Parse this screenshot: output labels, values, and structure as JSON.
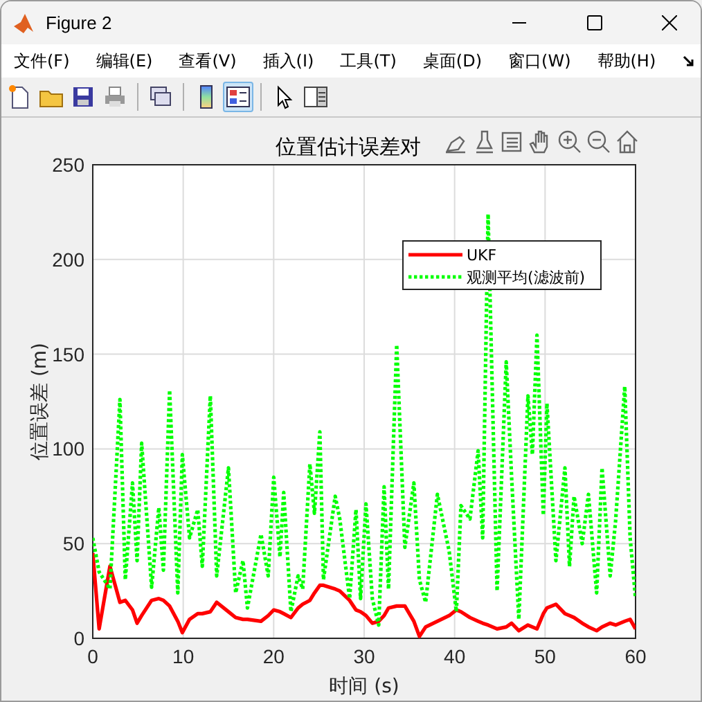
{
  "window": {
    "title": "Figure 2"
  },
  "menu": [
    "文件(F)",
    "编辑(E)",
    "查看(V)",
    "插入(I)",
    "工具(T)",
    "桌面(D)",
    "窗口(W)",
    "帮助(H)"
  ],
  "toolbar": [
    {
      "kind": "new",
      "selected": false
    },
    {
      "kind": "open",
      "selected": false
    },
    {
      "kind": "save",
      "selected": false
    },
    {
      "kind": "print",
      "selected": false
    },
    {
      "kind": "link",
      "selected": false
    },
    {
      "kind": "colorbar",
      "selected": false
    },
    {
      "kind": "legend",
      "selected": true
    },
    {
      "kind": "pointer",
      "selected": false
    },
    {
      "kind": "inspector",
      "selected": false
    }
  ],
  "axes": {
    "chart_data": {
      "type": "line",
      "title": "位置估计误差对",
      "xlabel": "时间 (s)",
      "ylabel": "位置误差 (m)",
      "x": [
        0,
        0.7,
        1.9,
        3,
        3.6,
        4.4,
        4.9,
        5.4,
        6.5,
        7.3,
        7.8,
        8.5,
        9.4,
        9.9,
        10.7,
        11.6,
        12.1,
        13,
        13.7,
        15,
        15.8,
        16.6,
        17.1,
        18.6,
        19.4,
        20,
        20.7,
        21.1,
        21.9,
        22.7,
        23.2,
        24,
        24.5,
        25.1,
        25.5,
        26.8,
        27.3,
        28.4,
        29.1,
        29.6,
        30.2,
        30.9,
        31.6,
        32.2,
        32.7,
        33.6,
        34.5,
        35.5,
        36.1,
        36.8,
        38.1,
        39.4,
        40.2,
        40.7,
        41.7,
        42.6,
        43.1,
        43.7,
        44.7,
        45.7,
        46.3,
        47.1,
        48.1,
        48.6,
        49.1,
        49.8,
        50.2,
        51.2,
        52.2,
        52.7,
        53.2,
        54.1,
        54.8,
        55.7,
        56.3,
        57.2,
        57.8,
        58.8,
        59.4,
        60
      ],
      "series": [
        {
          "name": "UKF",
          "color": "#ff0000",
          "line_style": "solid",
          "values": [
            45,
            5,
            38,
            19,
            20,
            15,
            8,
            12,
            20,
            21,
            20,
            17,
            9,
            3,
            10,
            13,
            13,
            14,
            19,
            14,
            11,
            10,
            10,
            9,
            12,
            15,
            14,
            13,
            11,
            16,
            18,
            20,
            24,
            28,
            28,
            26,
            25,
            20,
            15,
            14,
            12,
            8,
            9,
            12,
            16,
            17,
            17,
            9,
            1,
            6,
            9,
            12,
            15,
            14,
            11,
            9,
            8,
            7,
            5,
            6,
            8,
            4,
            7,
            6,
            5,
            13,
            16,
            18,
            13,
            12,
            11,
            8,
            6,
            4,
            6,
            8,
            7,
            9,
            10,
            5
          ]
        },
        {
          "name": "观测平均(滤波前)",
          "color": "#00ff00",
          "line_style": "dotted",
          "values": [
            53,
            35,
            26,
            126,
            31,
            82,
            41,
            103,
            27,
            69,
            36,
            131,
            24,
            97,
            53,
            68,
            38,
            128,
            33,
            90,
            24,
            41,
            16,
            55,
            33,
            85,
            43,
            77,
            14,
            33,
            26,
            92,
            66,
            109,
            31,
            75,
            63,
            21,
            68,
            21,
            71,
            21,
            7,
            80,
            26,
            155,
            48,
            82,
            31,
            19,
            76,
            46,
            14,
            70,
            63,
            99,
            53,
            224,
            25,
            146,
            85,
            10,
            128,
            97,
            160,
            65,
            124,
            41,
            90,
            38,
            75,
            50,
            76,
            24,
            90,
            33,
            62,
            133,
            53,
            21
          ]
        }
      ],
      "xlim": [
        0,
        60
      ],
      "ylim": [
        0,
        250
      ],
      "xticks": [
        0,
        10,
        20,
        30,
        40,
        50,
        60
      ],
      "yticks": [
        0,
        50,
        100,
        150,
        200,
        250
      ],
      "grid": true,
      "legend": true
    }
  }
}
